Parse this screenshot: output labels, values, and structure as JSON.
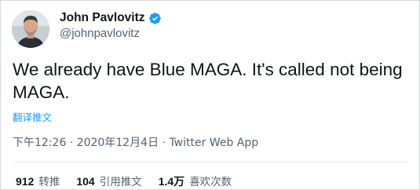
{
  "user": {
    "display_name": "John Pavlovitz",
    "handle": "@johnpavlovitz",
    "verified": true
  },
  "tweet": {
    "text": "We already have Blue MAGA. It's called not being MAGA.",
    "translate_label": "翻译推文",
    "time": "下午12:26",
    "separator_1": "·",
    "date": "2020年12月4日",
    "separator_2": "·",
    "source": "Twitter Web App"
  },
  "stats": {
    "retweets": {
      "count": "912",
      "label": "转推"
    },
    "quotes": {
      "count": "104",
      "label": "引用推文"
    },
    "likes": {
      "count": "1.4万",
      "label": "喜欢次数"
    }
  },
  "colors": {
    "link": "#1d9bf0",
    "muted": "#536471",
    "text": "#0f1419",
    "verified_badge": "#1d9bf0"
  },
  "icons": {
    "verified": "verified-badge-icon"
  }
}
